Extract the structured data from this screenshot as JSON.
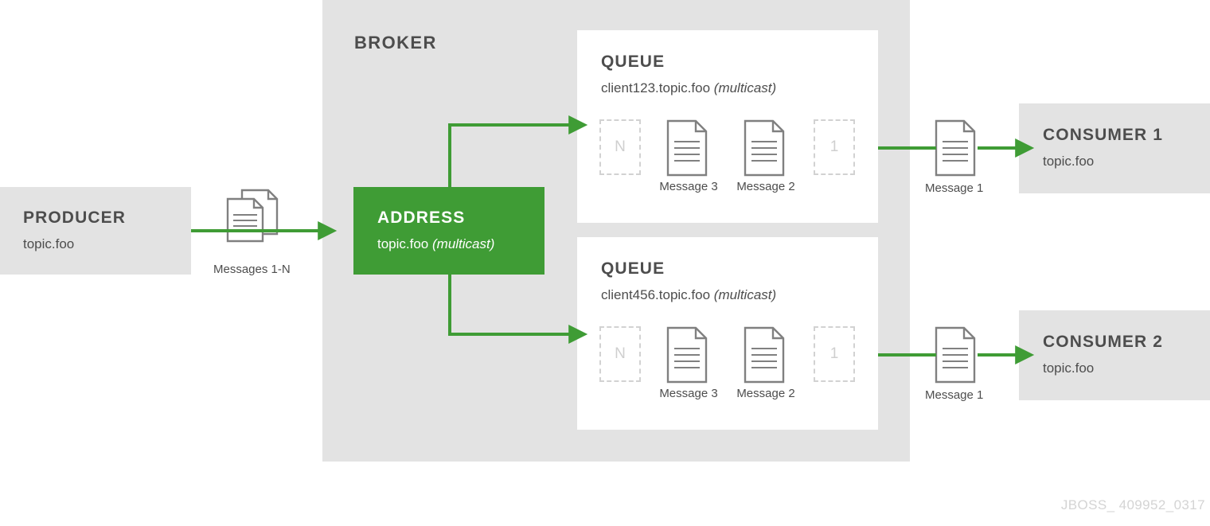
{
  "diagram": {
    "watermark": "JBOSS_ 409952_0317",
    "colors": {
      "green": "#3f9c35",
      "gray_box": "#e3e3e3",
      "text": "#4d4d4d",
      "placeholder": "#cfcfcf",
      "icon_outline": "#808080"
    }
  },
  "broker": {
    "label": "BROKER"
  },
  "producer": {
    "title": "PRODUCER",
    "subtitle": "topic.foo",
    "messages_caption": "Messages 1-N"
  },
  "address": {
    "title": "ADDRESS",
    "name": "topic.foo",
    "routing_type": "(multicast)"
  },
  "queues": [
    {
      "title": "QUEUE",
      "name": "client123.topic.foo",
      "routing_type": "(multicast)",
      "slots": [
        {
          "kind": "placeholder",
          "label": "N",
          "caption": ""
        },
        {
          "kind": "message",
          "label": "",
          "caption": "Message 3"
        },
        {
          "kind": "message",
          "label": "",
          "caption": "Message 2"
        },
        {
          "kind": "placeholder",
          "label": "1",
          "caption": ""
        }
      ]
    },
    {
      "title": "QUEUE",
      "name": "client456.topic.foo",
      "routing_type": "(multicast)",
      "slots": [
        {
          "kind": "placeholder",
          "label": "N",
          "caption": ""
        },
        {
          "kind": "message",
          "label": "",
          "caption": "Message 3"
        },
        {
          "kind": "message",
          "label": "",
          "caption": "Message 2"
        },
        {
          "kind": "placeholder",
          "label": "1",
          "caption": ""
        }
      ]
    }
  ],
  "consumers": [
    {
      "title": "CONSUMER 1",
      "subtitle": "topic.foo",
      "delivered_message_caption": "Message 1"
    },
    {
      "title": "CONSUMER 2",
      "subtitle": "topic.foo",
      "delivered_message_caption": "Message 1"
    }
  ]
}
